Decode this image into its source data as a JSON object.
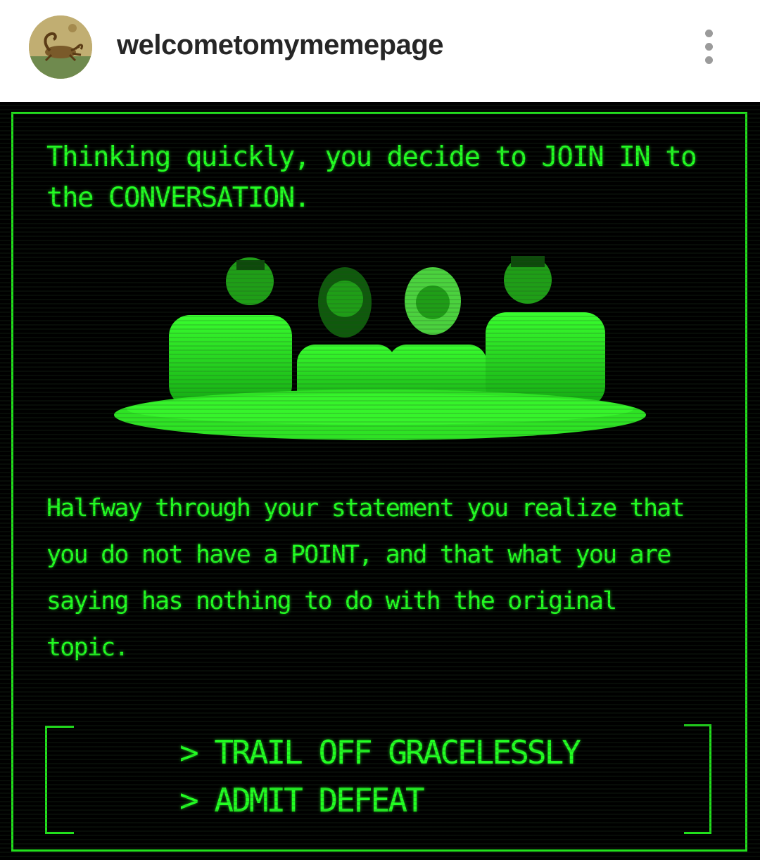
{
  "header": {
    "username": "welcometomymemepage",
    "avatar_icon": "scorpion-painting-avatar",
    "more_icon": "vertical-dots-icon"
  },
  "post": {
    "intro_text": "Thinking quickly, you decide to JOIN IN to the CONVERSATION.",
    "body_text": "Halfway through your statement you realize that you do not have a POINT, and that what you are saying has nothing to do with the original topic.",
    "options": [
      "> TRAIL OFF GRACELESSLY",
      "> ADMIT DEFEAT"
    ],
    "colors": {
      "terminal_green": "#22ff22",
      "background": "#000000"
    }
  }
}
